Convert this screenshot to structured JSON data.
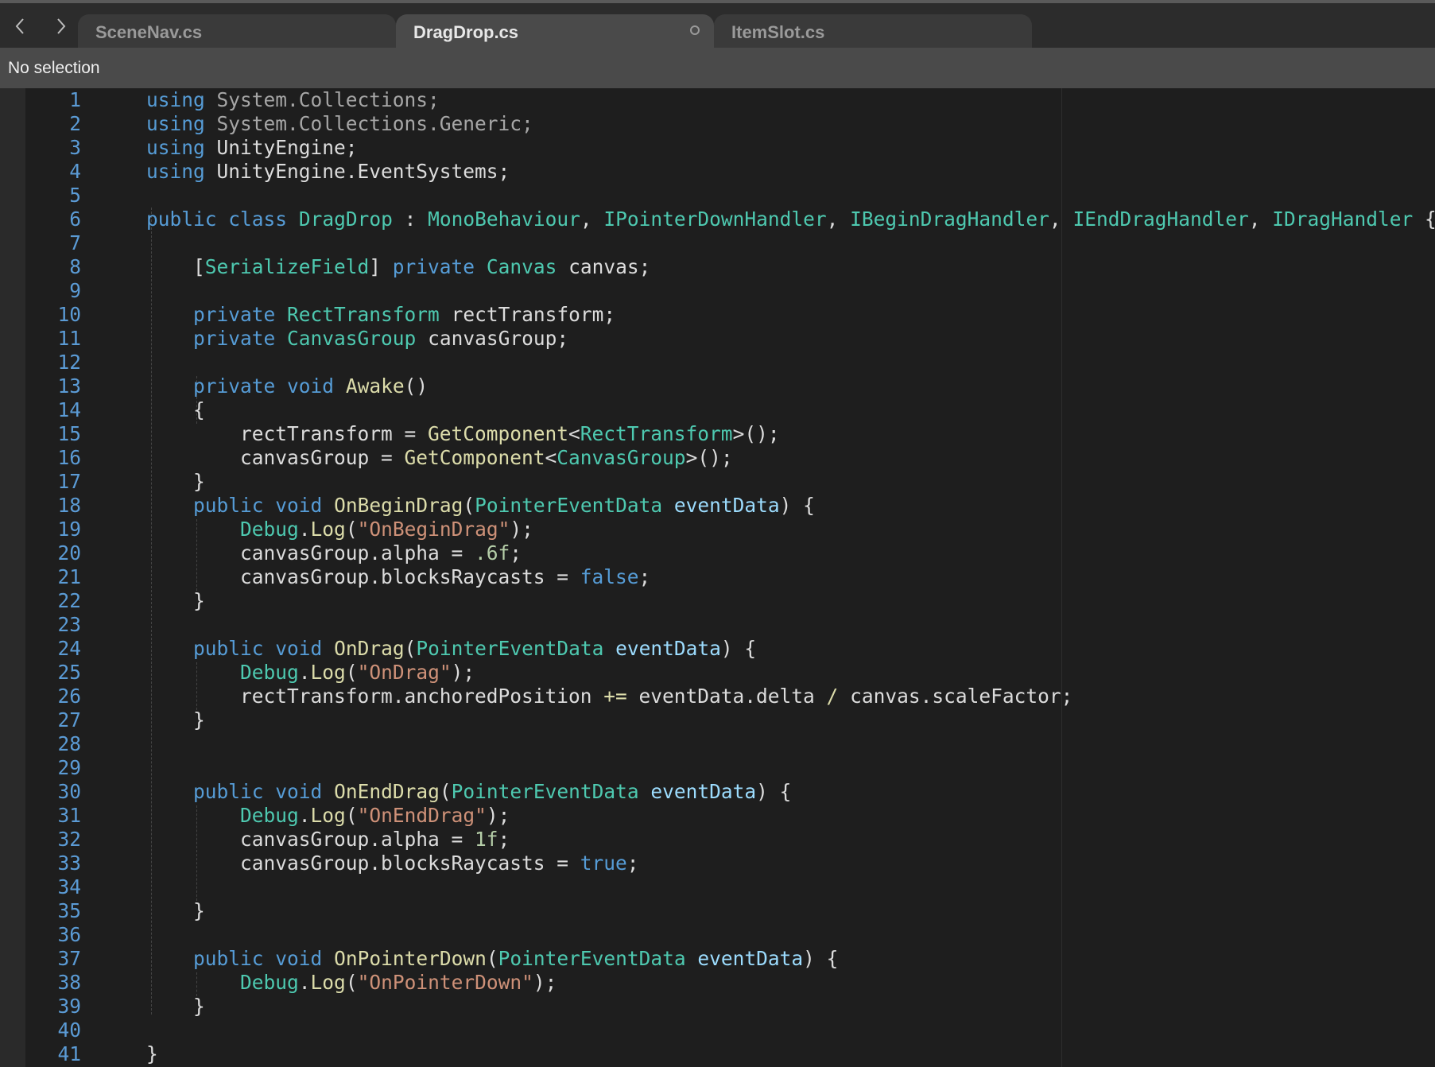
{
  "nav": {
    "back_icon": "chevron-left-icon",
    "forward_icon": "chevron-right-icon"
  },
  "tabs": [
    {
      "label": "SceneNav.cs",
      "active": false
    },
    {
      "label": "DragDrop.cs",
      "active": true,
      "unsaved": true
    },
    {
      "label": "ItemSlot.cs",
      "active": false
    }
  ],
  "status": {
    "selection_text": "No selection"
  },
  "colors": {
    "keyword": "#569cd6",
    "type": "#4ec9b0",
    "function": "#dcdcaa",
    "parameter": "#9cdcfe",
    "string": "#ce9178",
    "number": "#b5cea8",
    "line_number": "#5b9bd5"
  },
  "editor": {
    "lines": [
      [
        [
          "kw",
          "using"
        ],
        [
          "dim",
          " System.Collections;"
        ]
      ],
      [
        [
          "kw",
          "using"
        ],
        [
          "dim",
          " System.Collections.Generic;"
        ]
      ],
      [
        [
          "kw",
          "using"
        ],
        [
          "pl",
          " UnityEngine;"
        ]
      ],
      [
        [
          "kw",
          "using"
        ],
        [
          "pl",
          " UnityEngine.EventSystems;"
        ]
      ],
      [],
      [
        [
          "kw",
          "public"
        ],
        [
          "pl",
          " "
        ],
        [
          "kw",
          "class"
        ],
        [
          "pl",
          " "
        ],
        [
          "ty",
          "DragDrop"
        ],
        [
          "pl",
          " : "
        ],
        [
          "ty",
          "MonoBehaviour"
        ],
        [
          "pl",
          ", "
        ],
        [
          "ty",
          "IPointerDownHandler"
        ],
        [
          "pl",
          ", "
        ],
        [
          "ty",
          "IBeginDragHandler"
        ],
        [
          "pl",
          ", "
        ],
        [
          "ty",
          "IEndDragHandler"
        ],
        [
          "pl",
          ", "
        ],
        [
          "ty",
          "IDragHandler"
        ],
        [
          "pl",
          " {"
        ]
      ],
      [],
      [
        [
          "pl",
          "    ["
        ],
        [
          "ty",
          "SerializeField"
        ],
        [
          "pl",
          "] "
        ],
        [
          "kw",
          "private"
        ],
        [
          "pl",
          " "
        ],
        [
          "ty",
          "Canvas"
        ],
        [
          "pl",
          " canvas;"
        ]
      ],
      [],
      [
        [
          "pl",
          "    "
        ],
        [
          "kw",
          "private"
        ],
        [
          "pl",
          " "
        ],
        [
          "ty",
          "RectTransform"
        ],
        [
          "pl",
          " rectTransform;"
        ]
      ],
      [
        [
          "pl",
          "    "
        ],
        [
          "kw",
          "private"
        ],
        [
          "pl",
          " "
        ],
        [
          "ty",
          "CanvasGroup"
        ],
        [
          "pl",
          " canvasGroup;"
        ]
      ],
      [],
      [
        [
          "pl",
          "    "
        ],
        [
          "kw",
          "private"
        ],
        [
          "pl",
          " "
        ],
        [
          "kw",
          "void"
        ],
        [
          "pl",
          " "
        ],
        [
          "fn",
          "Awake"
        ],
        [
          "pl",
          "()"
        ]
      ],
      [
        [
          "pl",
          "    {"
        ]
      ],
      [
        [
          "pl",
          "        rectTransform = "
        ],
        [
          "fn",
          "GetComponent"
        ],
        [
          "pl",
          "<"
        ],
        [
          "ty",
          "RectTransform"
        ],
        [
          "pl",
          ">();"
        ]
      ],
      [
        [
          "pl",
          "        canvasGroup = "
        ],
        [
          "fn",
          "GetComponent"
        ],
        [
          "pl",
          "<"
        ],
        [
          "ty",
          "CanvasGroup"
        ],
        [
          "pl",
          ">();"
        ]
      ],
      [
        [
          "pl",
          "    }"
        ]
      ],
      [
        [
          "pl",
          "    "
        ],
        [
          "kw",
          "public"
        ],
        [
          "pl",
          " "
        ],
        [
          "kw",
          "void"
        ],
        [
          "pl",
          " "
        ],
        [
          "fn",
          "OnBeginDrag"
        ],
        [
          "pl",
          "("
        ],
        [
          "ty",
          "PointerEventData"
        ],
        [
          "pl",
          " "
        ],
        [
          "pa",
          "eventData"
        ],
        [
          "pl",
          ") {"
        ]
      ],
      [
        [
          "pl",
          "        "
        ],
        [
          "ty",
          "Debug"
        ],
        [
          "pl",
          "."
        ],
        [
          "fn",
          "Log"
        ],
        [
          "pl",
          "("
        ],
        [
          "st",
          "\"OnBeginDrag\""
        ],
        [
          "pl",
          ");"
        ]
      ],
      [
        [
          "pl",
          "        canvasGroup.alpha = "
        ],
        [
          "nu",
          ".6f"
        ],
        [
          "pl",
          ";"
        ]
      ],
      [
        [
          "pl",
          "        canvasGroup.blocksRaycasts = "
        ],
        [
          "kw",
          "false"
        ],
        [
          "pl",
          ";"
        ]
      ],
      [
        [
          "pl",
          "    }"
        ]
      ],
      [],
      [
        [
          "pl",
          "    "
        ],
        [
          "kw",
          "public"
        ],
        [
          "pl",
          " "
        ],
        [
          "kw",
          "void"
        ],
        [
          "pl",
          " "
        ],
        [
          "fn",
          "OnDrag"
        ],
        [
          "pl",
          "("
        ],
        [
          "ty",
          "PointerEventData"
        ],
        [
          "pl",
          " "
        ],
        [
          "pa",
          "eventData"
        ],
        [
          "pl",
          ") {"
        ]
      ],
      [
        [
          "pl",
          "        "
        ],
        [
          "ty",
          "Debug"
        ],
        [
          "pl",
          "."
        ],
        [
          "fn",
          "Log"
        ],
        [
          "pl",
          "("
        ],
        [
          "st",
          "\"OnDrag\""
        ],
        [
          "pl",
          ");"
        ]
      ],
      [
        [
          "pl",
          "        rectTransform.anchoredPosition "
        ],
        [
          "fn",
          "+="
        ],
        [
          "pl",
          " eventData.delta "
        ],
        [
          "fn",
          "/"
        ],
        [
          "pl",
          " canvas.scaleFactor;"
        ]
      ],
      [
        [
          "pl",
          "    }"
        ]
      ],
      [],
      [],
      [
        [
          "pl",
          "    "
        ],
        [
          "kw",
          "public"
        ],
        [
          "pl",
          " "
        ],
        [
          "kw",
          "void"
        ],
        [
          "pl",
          " "
        ],
        [
          "fn",
          "OnEndDrag"
        ],
        [
          "pl",
          "("
        ],
        [
          "ty",
          "PointerEventData"
        ],
        [
          "pl",
          " "
        ],
        [
          "pa",
          "eventData"
        ],
        [
          "pl",
          ") {"
        ]
      ],
      [
        [
          "pl",
          "        "
        ],
        [
          "ty",
          "Debug"
        ],
        [
          "pl",
          "."
        ],
        [
          "fn",
          "Log"
        ],
        [
          "pl",
          "("
        ],
        [
          "st",
          "\"OnEndDrag\""
        ],
        [
          "pl",
          ");"
        ]
      ],
      [
        [
          "pl",
          "        canvasGroup.alpha = "
        ],
        [
          "nu",
          "1f"
        ],
        [
          "pl",
          ";"
        ]
      ],
      [
        [
          "pl",
          "        canvasGroup.blocksRaycasts = "
        ],
        [
          "kw",
          "true"
        ],
        [
          "pl",
          ";"
        ]
      ],
      [],
      [
        [
          "pl",
          "    }"
        ]
      ],
      [],
      [
        [
          "pl",
          "    "
        ],
        [
          "kw",
          "public"
        ],
        [
          "pl",
          " "
        ],
        [
          "kw",
          "void"
        ],
        [
          "pl",
          " "
        ],
        [
          "fn",
          "OnPointerDown"
        ],
        [
          "pl",
          "("
        ],
        [
          "ty",
          "PointerEventData"
        ],
        [
          "pl",
          " "
        ],
        [
          "pa",
          "eventData"
        ],
        [
          "pl",
          ") {"
        ]
      ],
      [
        [
          "pl",
          "        "
        ],
        [
          "ty",
          "Debug"
        ],
        [
          "pl",
          "."
        ],
        [
          "fn",
          "Log"
        ],
        [
          "pl",
          "("
        ],
        [
          "st",
          "\"OnPointerDown\""
        ],
        [
          "pl",
          ");"
        ]
      ],
      [
        [
          "pl",
          "    }"
        ]
      ],
      [],
      [
        [
          "pl",
          "}"
        ]
      ]
    ]
  }
}
